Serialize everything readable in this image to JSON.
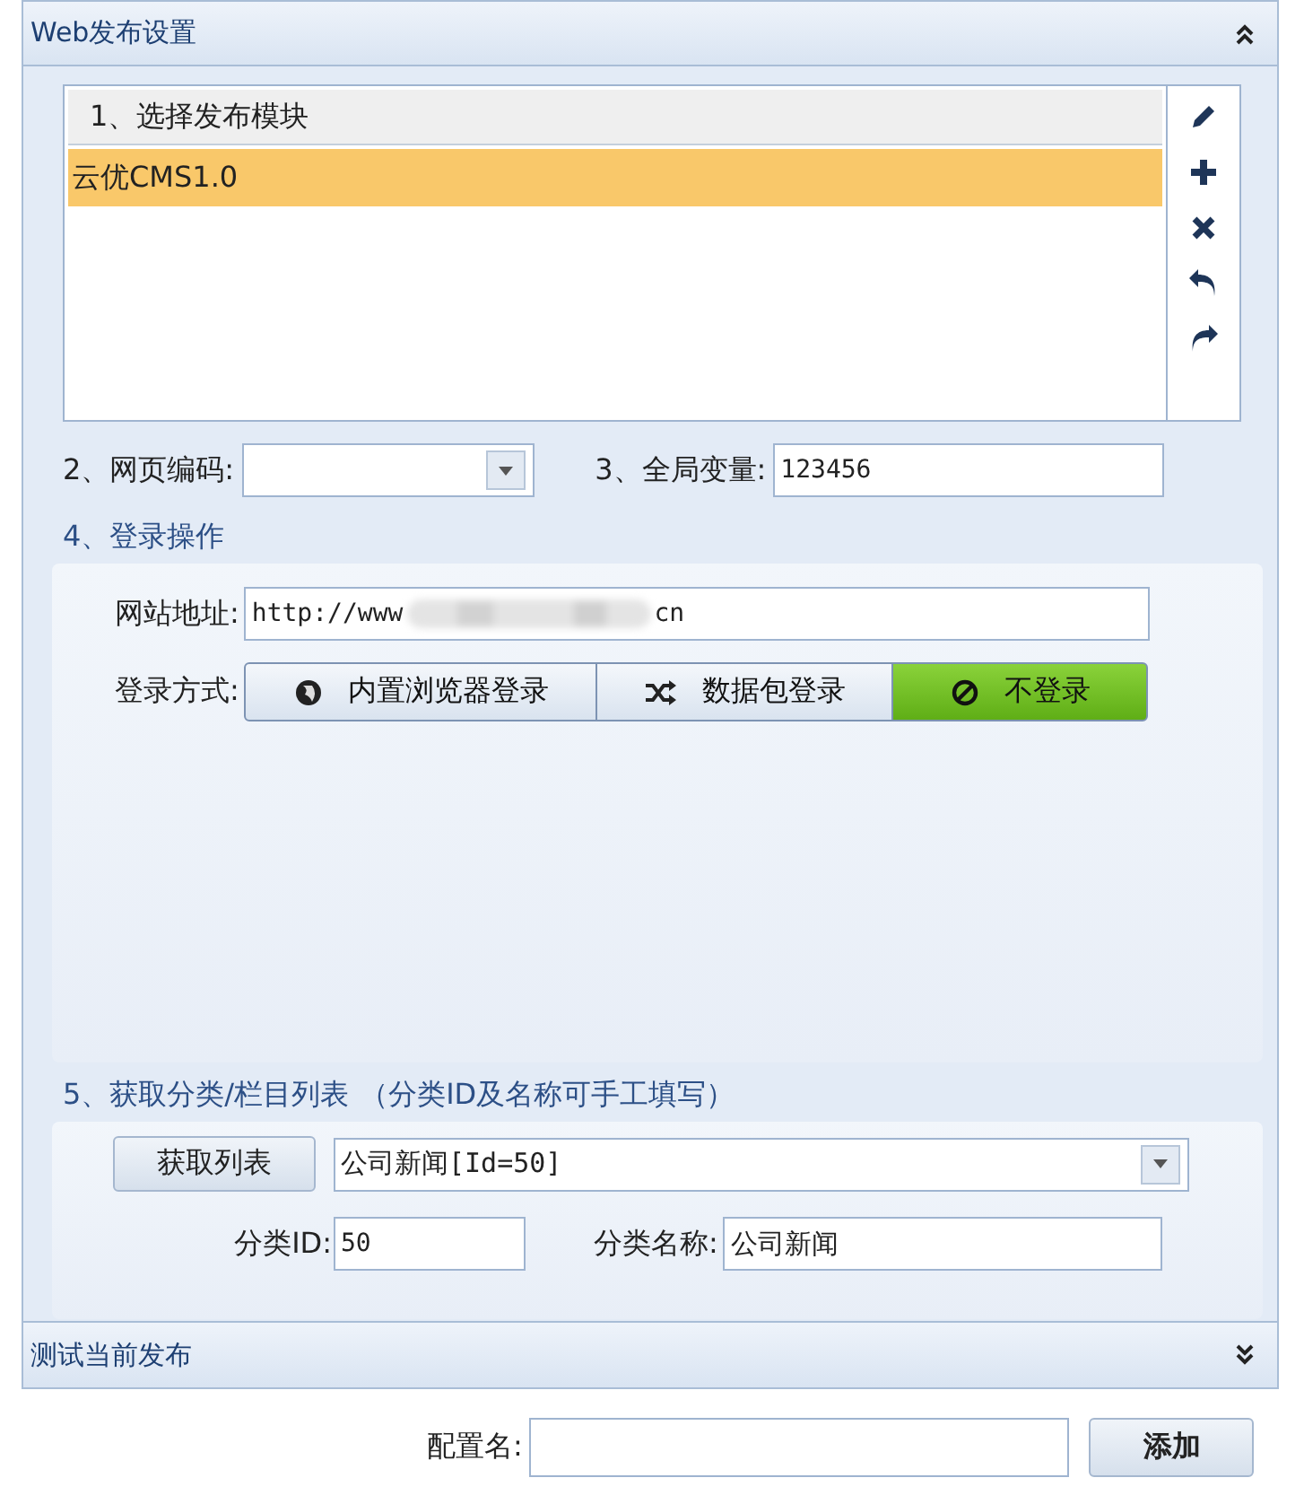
{
  "panel": {
    "title": "Web发布设置",
    "collapsed": false
  },
  "module_list": {
    "header": "1、选择发布模块",
    "items": [
      {
        "label": "云优CMS1.0",
        "selected": true
      }
    ]
  },
  "encoding": {
    "label": "2、网页编码:"
  },
  "global_var": {
    "label": "3、全局变量:",
    "value": "123456"
  },
  "login": {
    "title": "4、登录操作",
    "url_label": "网站地址:",
    "url_start": "http://www",
    "url_end": "cn",
    "method_label": "登录方式:",
    "methods": [
      {
        "label": "内置浏览器登录",
        "kind": "browser",
        "selected": false
      },
      {
        "label": "数据包登录",
        "kind": "packet",
        "selected": false
      },
      {
        "label": "不登录",
        "kind": "none",
        "selected": true
      }
    ]
  },
  "category": {
    "title": "5、获取分类/栏目列表",
    "note": "（分类ID及名称可手工填写）",
    "fetch_button": "获取列表",
    "list_value": "公司新闻[Id=50]",
    "id_label": "分类ID:",
    "id_value": "50",
    "name_label": "分类名称:",
    "name_value": "公司新闻"
  },
  "test_panel": {
    "title": "测试当前发布",
    "collapsed": true
  },
  "config": {
    "label": "配置名:",
    "button": "添加"
  }
}
